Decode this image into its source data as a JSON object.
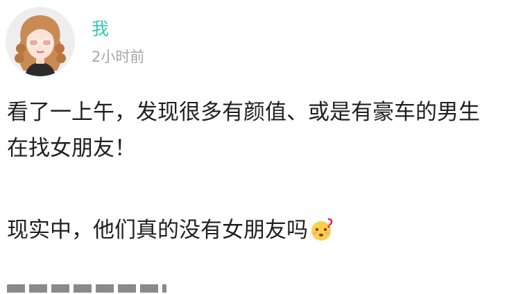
{
  "user": {
    "name": "我",
    "time": "2小时前",
    "avatar_icon": "user-avatar-girl-sunglasses"
  },
  "post": {
    "paragraph1_line1": "看了一上午，发现很多有颜值、或是有豪车的男生",
    "paragraph1_line2": "在找女朋友！",
    "paragraph2": "现实中，他们真的没有女朋友吗",
    "emoji": "thinking-face-emoji"
  },
  "colors": {
    "username": "#33c7b9",
    "timestamp": "#a6a6a6",
    "text": "#1f1f1f",
    "background": "#ffffff"
  }
}
